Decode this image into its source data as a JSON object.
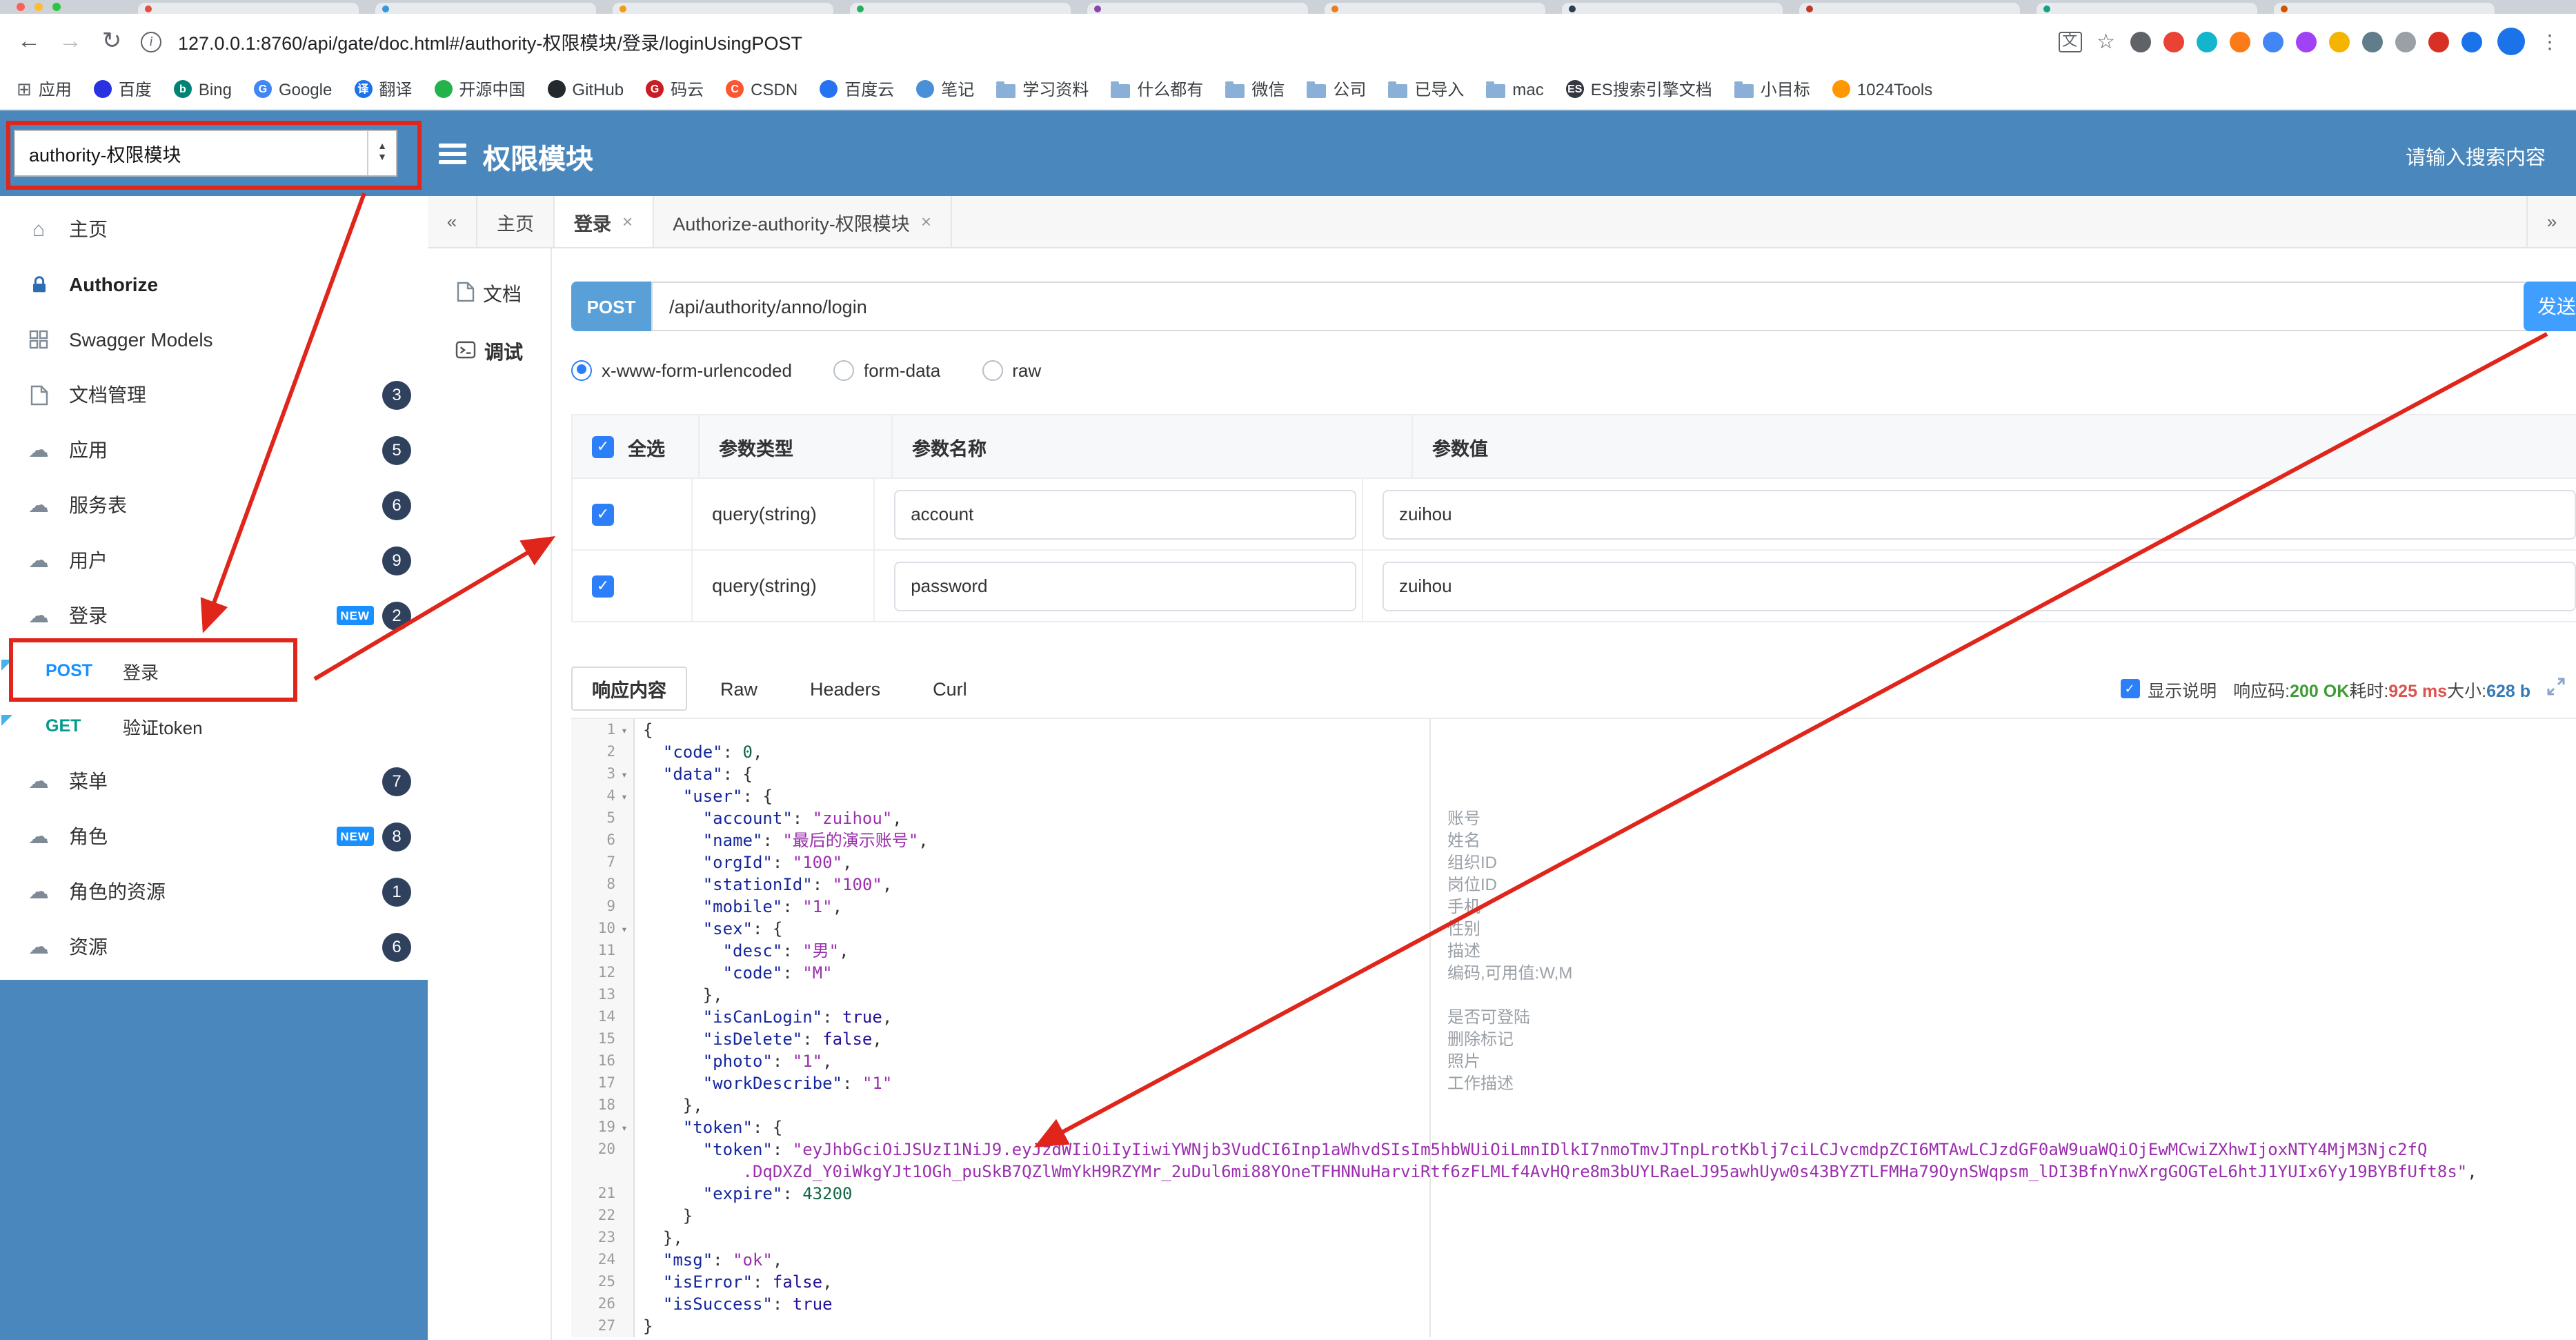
{
  "browser": {
    "url": "127.0.0.1:8760/api/gate/doc.html#/authority-权限模块/登录/loginUsingPOST",
    "bookmarks": [
      {
        "label": "应用",
        "icon": "apps"
      },
      {
        "label": "百度",
        "icon": "fav",
        "color": "#2932e1"
      },
      {
        "label": "Bing",
        "icon": "fav",
        "color": "#008373",
        "glyph": "b"
      },
      {
        "label": "Google",
        "icon": "fav",
        "color": "#4285f4",
        "glyph": "G"
      },
      {
        "label": "翻译",
        "icon": "fav",
        "color": "#1a73e8",
        "glyph": "译"
      },
      {
        "label": "开源中国",
        "icon": "fav",
        "color": "#24b34b"
      },
      {
        "label": "GitHub",
        "icon": "fav",
        "color": "#24292e"
      },
      {
        "label": "码云",
        "icon": "fav",
        "color": "#c71d23",
        "glyph": "G"
      },
      {
        "label": "CSDN",
        "icon": "fav",
        "color": "#fc5531",
        "glyph": "C"
      },
      {
        "label": "百度云",
        "icon": "fav",
        "color": "#2772f0"
      },
      {
        "label": "笔记",
        "icon": "fav",
        "color": "#4a90d9"
      },
      {
        "label": "学习资料",
        "icon": "folder"
      },
      {
        "label": "什么都有",
        "icon": "folder"
      },
      {
        "label": "微信",
        "icon": "folder"
      },
      {
        "label": "公司",
        "icon": "folder"
      },
      {
        "label": "已导入",
        "icon": "folder"
      },
      {
        "label": "mac",
        "icon": "folder"
      },
      {
        "label": "ES搜索引擎文档",
        "icon": "fav",
        "color": "#343741",
        "glyph": "ES"
      },
      {
        "label": "小目标",
        "icon": "folder"
      },
      {
        "label": "1024Tools",
        "icon": "fav",
        "color": "#ff9800"
      }
    ]
  },
  "header": {
    "module_select": "authority-权限模块",
    "title": "权限模块",
    "search_placeholder": "请输入搜索内容"
  },
  "sidebar": {
    "items": [
      {
        "label": "主页",
        "icon": "home"
      },
      {
        "label": "Authorize",
        "icon": "auth",
        "bold": true
      },
      {
        "label": "Swagger Models",
        "icon": "models"
      },
      {
        "label": "文档管理",
        "icon": "doc",
        "badge": "3"
      },
      {
        "label": "应用",
        "icon": "cloud",
        "badge": "5"
      },
      {
        "label": "服务表",
        "icon": "cloud",
        "badge": "6"
      },
      {
        "label": "用户",
        "icon": "cloud",
        "badge": "9"
      },
      {
        "label": "登录",
        "icon": "cloud",
        "badge": "2",
        "new": true
      },
      {
        "method": "POST",
        "label": "登录",
        "sub": true
      },
      {
        "method": "GET",
        "label": "验证token",
        "sub": true
      },
      {
        "label": "菜单",
        "icon": "cloud",
        "badge": "7"
      },
      {
        "label": "角色",
        "icon": "cloud",
        "badge": "8",
        "new": true
      },
      {
        "label": "角色的资源",
        "icon": "cloud",
        "badge": "1"
      },
      {
        "label": "资源",
        "icon": "cloud",
        "badge": "6"
      }
    ]
  },
  "workspace": {
    "tabs": [
      {
        "label": "主页",
        "closable": false
      },
      {
        "label": "登录",
        "closable": true,
        "active": true
      },
      {
        "label": "Authorize-authority-权限模块",
        "closable": true
      }
    ],
    "doc_nav": [
      {
        "label": "文档",
        "icon": "doc"
      },
      {
        "label": "调试",
        "icon": "debug",
        "active": true
      }
    ]
  },
  "request": {
    "method": "POST",
    "url": "/api/authority/anno/login",
    "send_label": "发送",
    "content_types": [
      {
        "label": "x-www-form-urlencoded",
        "checked": true
      },
      {
        "label": "form-data",
        "checked": false
      },
      {
        "label": "raw",
        "checked": false
      }
    ],
    "table": {
      "select_all": "全选",
      "headers": [
        "参数类型",
        "参数名称",
        "参数值"
      ],
      "rows": [
        {
          "checked": true,
          "type": "query(string)",
          "name": "account",
          "value": "zuihou"
        },
        {
          "checked": true,
          "type": "query(string)",
          "name": "password",
          "value": "zuihou"
        }
      ]
    }
  },
  "response": {
    "tabs": [
      {
        "label": "响应内容",
        "active": true
      },
      {
        "label": "Raw",
        "active": false
      },
      {
        "label": "Headers",
        "active": false
      },
      {
        "label": "Curl",
        "active": false
      }
    ],
    "show_desc": "显示说明",
    "meta": {
      "code_label": "响应码:",
      "code": "200 OK",
      "time_label": "耗时:",
      "time": "925 ms",
      "size_label": "大小:",
      "size": "628 b"
    },
    "code_lines": [
      {
        "n": 1,
        "text": "{",
        "fold": true
      },
      {
        "n": 2,
        "text": "  \"code\": 0,"
      },
      {
        "n": 3,
        "text": "  \"data\": {",
        "fold": true
      },
      {
        "n": 4,
        "text": "    \"user\": {",
        "fold": true
      },
      {
        "n": 5,
        "text": "      \"account\": \"zuihou\","
      },
      {
        "n": 6,
        "text": "      \"name\": \"最后的演示账号\","
      },
      {
        "n": 7,
        "text": "      \"orgId\": \"100\","
      },
      {
        "n": 8,
        "text": "      \"stationId\": \"100\","
      },
      {
        "n": 9,
        "text": "      \"mobile\": \"1\","
      },
      {
        "n": 10,
        "text": "      \"sex\": {",
        "fold": true
      },
      {
        "n": 11,
        "text": "        \"desc\": \"男\","
      },
      {
        "n": 12,
        "text": "        \"code\": \"M\""
      },
      {
        "n": 13,
        "text": "      },"
      },
      {
        "n": 14,
        "text": "      \"isCanLogin\": true,"
      },
      {
        "n": 15,
        "text": "      \"isDelete\": false,"
      },
      {
        "n": 16,
        "text": "      \"photo\": \"1\","
      },
      {
        "n": 17,
        "text": "      \"workDescribe\": \"1\""
      },
      {
        "n": 18,
        "text": "    },"
      },
      {
        "n": 19,
        "text": "    \"token\": {",
        "fold": true
      },
      {
        "n": 20,
        "text": "      \"token\": \"eyJhbGciOiJSUzI1NiJ9.eyJzdWIiOiIyIiwiYWNjb3VudCI6Inp1aWhvdSIsIm5hbWUiOiLmnIDlkI7nmoTmvJTnpLrotKblj7ciLCJvcmdpZCI6MTAwLCJzdGF0aW9uaWQiOjEwMCwiZXhwIjoxNTY4MjM3Njc2fQ"
      },
      {
        "cont": true,
        "text": "          .DqDXZd_Y0iWkgYJt1OGh_puSkB7QZlWmYkH9RZYMr_2uDul6mi88YOneTFHNNuHarviRtf6zFLMLf4AvHQre8m3bUYLRaeLJ95awhUyw0s43BYZTLFMHa79OynSWqpsm_lDI3BfnYnwXrgGOGTeL6htJ1YUIx6Yy19BYBfUft8s\","
      },
      {
        "n": 21,
        "text": "      \"expire\": 43200"
      },
      {
        "n": 22,
        "text": "    }"
      },
      {
        "n": 23,
        "text": "  },"
      },
      {
        "n": 24,
        "text": "  \"msg\": \"ok\","
      },
      {
        "n": 25,
        "text": "  \"isError\": false,"
      },
      {
        "n": 26,
        "text": "  \"isSuccess\": true"
      },
      {
        "n": 27,
        "text": "}"
      }
    ],
    "annotations": [
      {
        "line": 5,
        "text": "账号"
      },
      {
        "line": 6,
        "text": "姓名"
      },
      {
        "line": 7,
        "text": "组织ID"
      },
      {
        "line": 8,
        "text": "岗位ID"
      },
      {
        "line": 9,
        "text": "手机"
      },
      {
        "line": 10,
        "text": "性别"
      },
      {
        "line": 11,
        "text": "描述"
      },
      {
        "line": 12,
        "text": "编码,可用值:W,M"
      },
      {
        "line": 14,
        "text": "是否可登陆"
      },
      {
        "line": 15,
        "text": "删除标记"
      },
      {
        "line": 16,
        "text": "照片"
      },
      {
        "line": 17,
        "text": "工作描述"
      }
    ]
  }
}
